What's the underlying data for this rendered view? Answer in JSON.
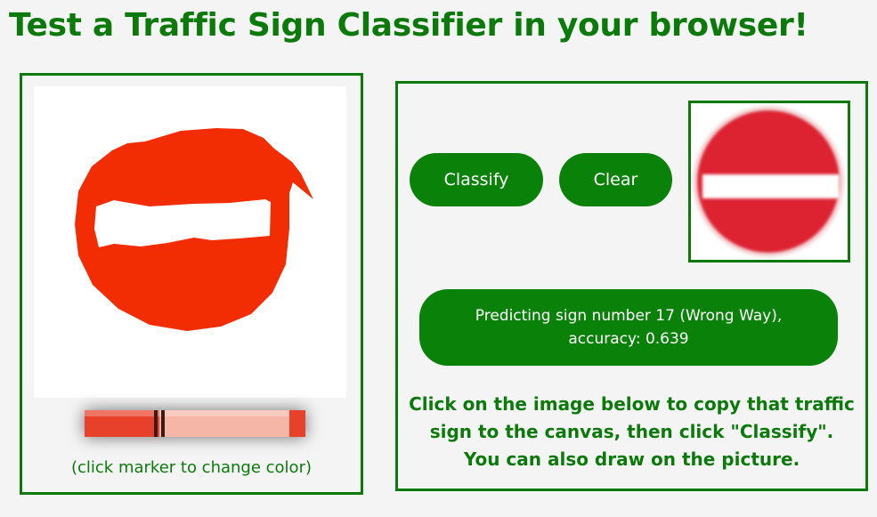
{
  "page": {
    "title": "Test a Traffic Sign Classifier in your browser!"
  },
  "drawing": {
    "hint": "(click marker to change color)",
    "marker_icon": "red-marker-icon",
    "marker_color": "#e8412b",
    "stroke_color": "#f22d03"
  },
  "controls": {
    "classify_label": "Classify",
    "clear_label": "Clear",
    "sample_sign_icon": "no-entry-sign-icon",
    "sign_color": "#dd2430"
  },
  "result": {
    "line1": "Predicting sign number 17 (Wrong Way),",
    "line2": "accuracy: 0.639"
  },
  "instructions": {
    "line1": "Click on the image below to copy that traffic",
    "line2": "sign to the canvas, then click \"Classify\".",
    "line3": "You can also draw on the picture."
  },
  "colors": {
    "accent": "#0b7a0b",
    "button": "#0a820a",
    "background": "#f4f4f4"
  }
}
